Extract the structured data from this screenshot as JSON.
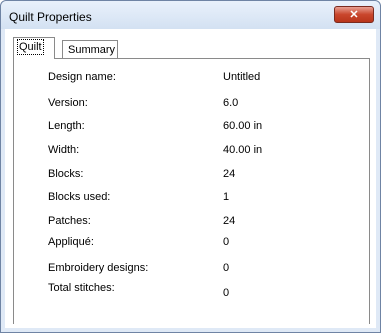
{
  "window": {
    "title": "Quilt Properties",
    "close_glyph": "✕"
  },
  "tabs": [
    {
      "label": "Quilt",
      "active": true
    },
    {
      "label": "Summary",
      "active": false
    }
  ],
  "properties": [
    {
      "label": "Design name:",
      "value": "Untitled"
    },
    {
      "label": "Version:",
      "value": "6.0"
    },
    {
      "label": "Length:",
      "value": "60.00 in"
    },
    {
      "label": "Width:",
      "value": "40.00 in"
    },
    {
      "label": "Blocks:",
      "value": "24"
    },
    {
      "label": "Blocks used:",
      "value": "1"
    },
    {
      "label": "Patches:",
      "value": "24"
    },
    {
      "label": "Appliqué:",
      "value": "0"
    },
    {
      "label": "Embroidery designs:",
      "value": "0"
    },
    {
      "label": "Total stitches:",
      "value": "0"
    }
  ],
  "colors": {
    "close_button": "#c9462c",
    "title_bar": "#dfe9f6"
  }
}
